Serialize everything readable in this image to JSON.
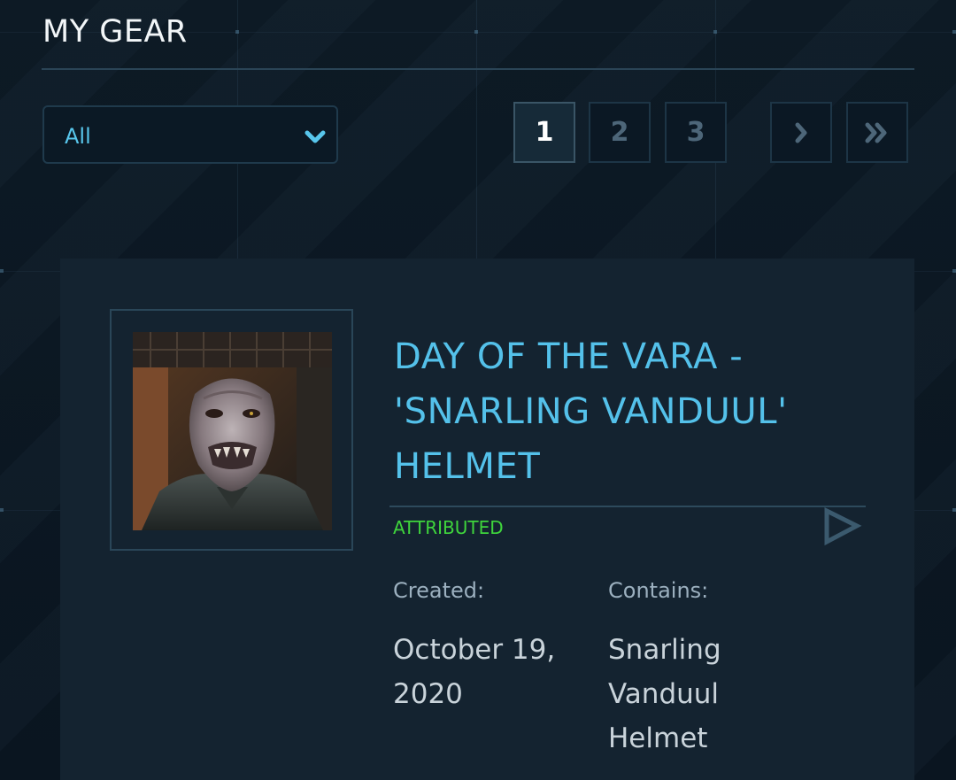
{
  "page": {
    "title": "MY GEAR"
  },
  "filter": {
    "selected": "All"
  },
  "pagination": {
    "pages": [
      "1",
      "2",
      "3"
    ],
    "active_page": "1",
    "next_icon": "chevron-right-icon",
    "last_icon": "double-chevron-right-icon"
  },
  "item": {
    "title_lines": [
      "DAY OF THE VARA -",
      "'SNARLING VANDUUL'",
      "HELMET"
    ],
    "status": "ATTRIBUTED",
    "created_label": "Created:",
    "created_value_lines": [
      "October 19,",
      "2020"
    ],
    "contains_label": "Contains:",
    "contains_value_lines": [
      "Snarling",
      "Vanduul",
      "Helmet"
    ],
    "thumbnail_alt": "Snarling Vanduul Helmet",
    "action_icon": "play-triangle-icon"
  },
  "colors": {
    "accent": "#54c1ea",
    "status": "#3fd53c",
    "background": "#0b1620",
    "card": "#142330"
  }
}
